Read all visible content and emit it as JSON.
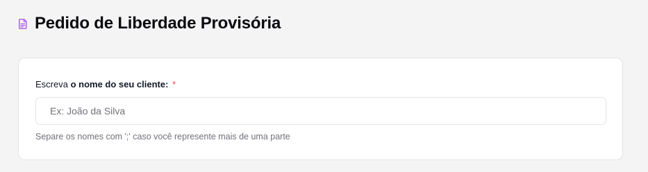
{
  "header": {
    "icon": "document-icon",
    "title": "Pedido de Liberdade Provisória"
  },
  "form": {
    "label_prefix": "Escreva ",
    "label_bold": "o nome do seu cliente:",
    "required_mark": "*",
    "input_value": "",
    "input_placeholder": "Ex: João da Silva",
    "helper": "Separe os nomes com ';' caso você represente mais de uma parte"
  },
  "colors": {
    "accent": "#a855f7",
    "required": "#ef4444",
    "background": "#f4f4f5",
    "card": "#ffffff"
  }
}
